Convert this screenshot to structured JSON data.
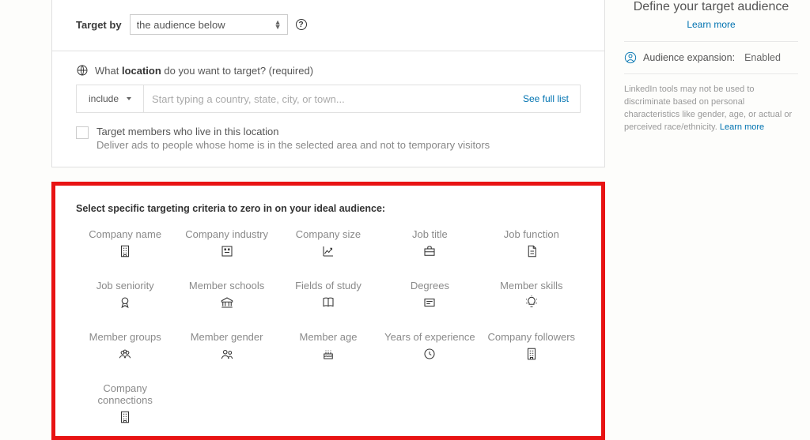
{
  "targetby": {
    "label": "Target by",
    "selected": "the audience below"
  },
  "location": {
    "prompt_prefix": "What ",
    "prompt_word": "location",
    "prompt_suffix": " do you want to target? (required)",
    "include_label": "include",
    "placeholder": "Start typing a country, state, city, or town...",
    "full_list": "See full list",
    "checkbox_title": "Target members who live in this location",
    "checkbox_desc": "Deliver ads to people whose home is in the selected area and not to temporary visitors"
  },
  "criteria_title": "Select specific targeting criteria to zero in on your ideal audience:",
  "criteria": [
    {
      "key": "company-name",
      "label": "Company name",
      "icon": "building"
    },
    {
      "key": "company-industry",
      "label": "Company industry",
      "icon": "industry"
    },
    {
      "key": "company-size",
      "label": "Company size",
      "icon": "chart"
    },
    {
      "key": "job-title",
      "label": "Job title",
      "icon": "briefcase"
    },
    {
      "key": "job-function",
      "label": "Job function",
      "icon": "document"
    },
    {
      "key": "job-seniority",
      "label": "Job seniority",
      "icon": "medal"
    },
    {
      "key": "member-schools",
      "label": "Member schools",
      "icon": "bank"
    },
    {
      "key": "fields-of-study",
      "label": "Fields of study",
      "icon": "book"
    },
    {
      "key": "degrees",
      "label": "Degrees",
      "icon": "diploma"
    },
    {
      "key": "member-skills",
      "label": "Member skills",
      "icon": "bulb"
    },
    {
      "key": "member-groups",
      "label": "Member groups",
      "icon": "group"
    },
    {
      "key": "member-gender",
      "label": "Member gender",
      "icon": "people"
    },
    {
      "key": "member-age",
      "label": "Member age",
      "icon": "cake"
    },
    {
      "key": "years-of-experience",
      "label": "Years of experience",
      "icon": "clock"
    },
    {
      "key": "company-followers",
      "label": "Company followers",
      "icon": "building"
    },
    {
      "key": "company-connections",
      "label": "Company connections",
      "icon": "building"
    }
  ],
  "sidebar": {
    "title": "Define your target audience",
    "learn": "Learn more",
    "expansion_label": "Audience expansion:",
    "expansion_value": "Enabled",
    "note": "LinkedIn tools may not be used to discriminate based on personal characteristics like gender, age, or actual or perceived race/ethnicity.",
    "note_link": "Learn more"
  }
}
